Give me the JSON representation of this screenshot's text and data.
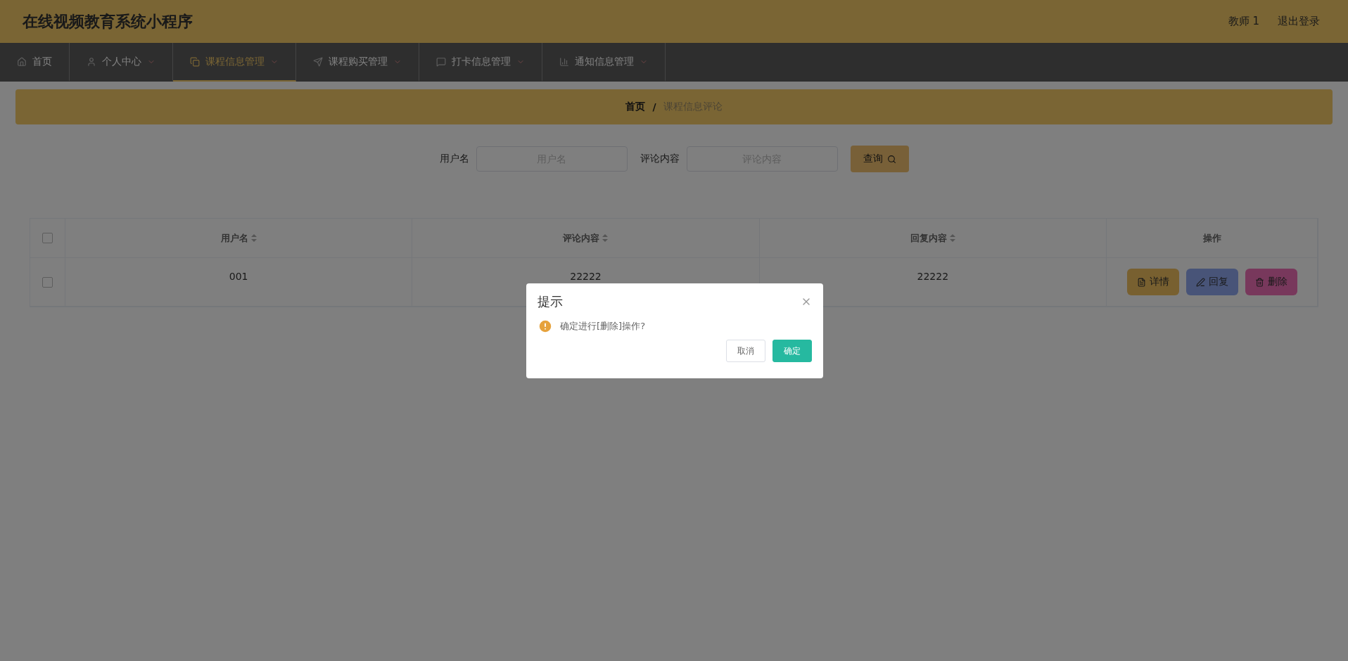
{
  "header": {
    "title": "在线视频教育系统小程序",
    "user": "教师 1",
    "logout": "退出登录"
  },
  "nav": [
    {
      "label": "首页",
      "kind": "home",
      "selected": false,
      "dropdown": false
    },
    {
      "label": "个人中心",
      "kind": "user",
      "selected": false,
      "dropdown": true
    },
    {
      "label": "课程信息管理",
      "kind": "copy",
      "selected": true,
      "dropdown": true
    },
    {
      "label": "课程购买管理",
      "kind": "send",
      "selected": false,
      "dropdown": true
    },
    {
      "label": "打卡信息管理",
      "kind": "chat",
      "selected": false,
      "dropdown": true
    },
    {
      "label": "通知信息管理",
      "kind": "chart",
      "selected": false,
      "dropdown": true
    }
  ],
  "breadcrumb": {
    "home": "首页",
    "separator": "/",
    "current": "课程信息评论"
  },
  "search": {
    "fields": [
      {
        "label": "用户名",
        "placeholder": "用户名"
      },
      {
        "label": "评论内容",
        "placeholder": "评论内容"
      }
    ],
    "button": "查询"
  },
  "table": {
    "header_checked": false,
    "columns": [
      {
        "label": "用户名",
        "sortable": true
      },
      {
        "label": "评论内容",
        "sortable": true
      },
      {
        "label": "回复内容",
        "sortable": true
      },
      {
        "label": "操作",
        "sortable": false
      }
    ],
    "rows": [
      {
        "checked": false,
        "cells": [
          "001",
          "22222",
          "22222"
        ],
        "actions": [
          {
            "label": "详情",
            "kind": "detail"
          },
          {
            "label": "回复",
            "kind": "reply"
          },
          {
            "label": "删除",
            "kind": "delete"
          }
        ]
      }
    ]
  },
  "dialog": {
    "title": "提示",
    "message": "确定进行[删除]操作?",
    "cancel": "取消",
    "confirm": "确定"
  }
}
